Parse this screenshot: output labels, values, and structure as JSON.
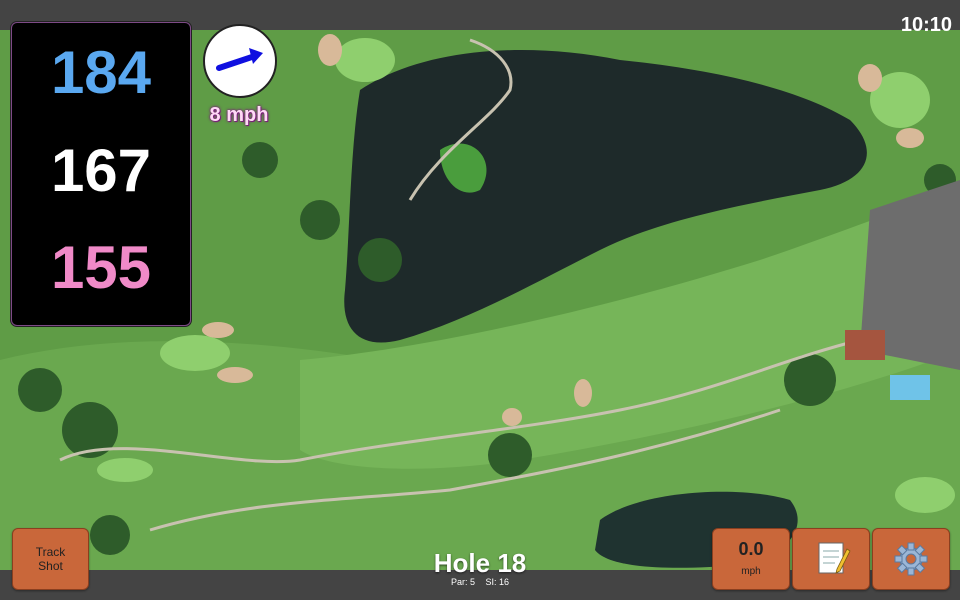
{
  "status": {
    "clock": "10:10"
  },
  "yardage": {
    "back": {
      "value": "184",
      "color": "#5aa8f0"
    },
    "middle": {
      "value": "167",
      "color": "#ffffff"
    },
    "front": {
      "value": "155",
      "color": "#f08ac8"
    }
  },
  "wind": {
    "icon": "wind-direction-arrow-icon",
    "speed_label": "8 mph"
  },
  "buttons": {
    "track_shot": {
      "line1": "Track",
      "line2": "Shot"
    },
    "wind_speed": {
      "value": "0.0",
      "unit": "mph"
    },
    "notes_icon": "notepad-icon",
    "settings_icon": "gear-icon"
  },
  "hole": {
    "title": "Hole 18",
    "par": "Par: 5",
    "stroke_index": "SI: 16"
  },
  "colors": {
    "button_bg": "#c9673a",
    "panel_bg": "#000000",
    "panel_border": "#7d4a86"
  }
}
